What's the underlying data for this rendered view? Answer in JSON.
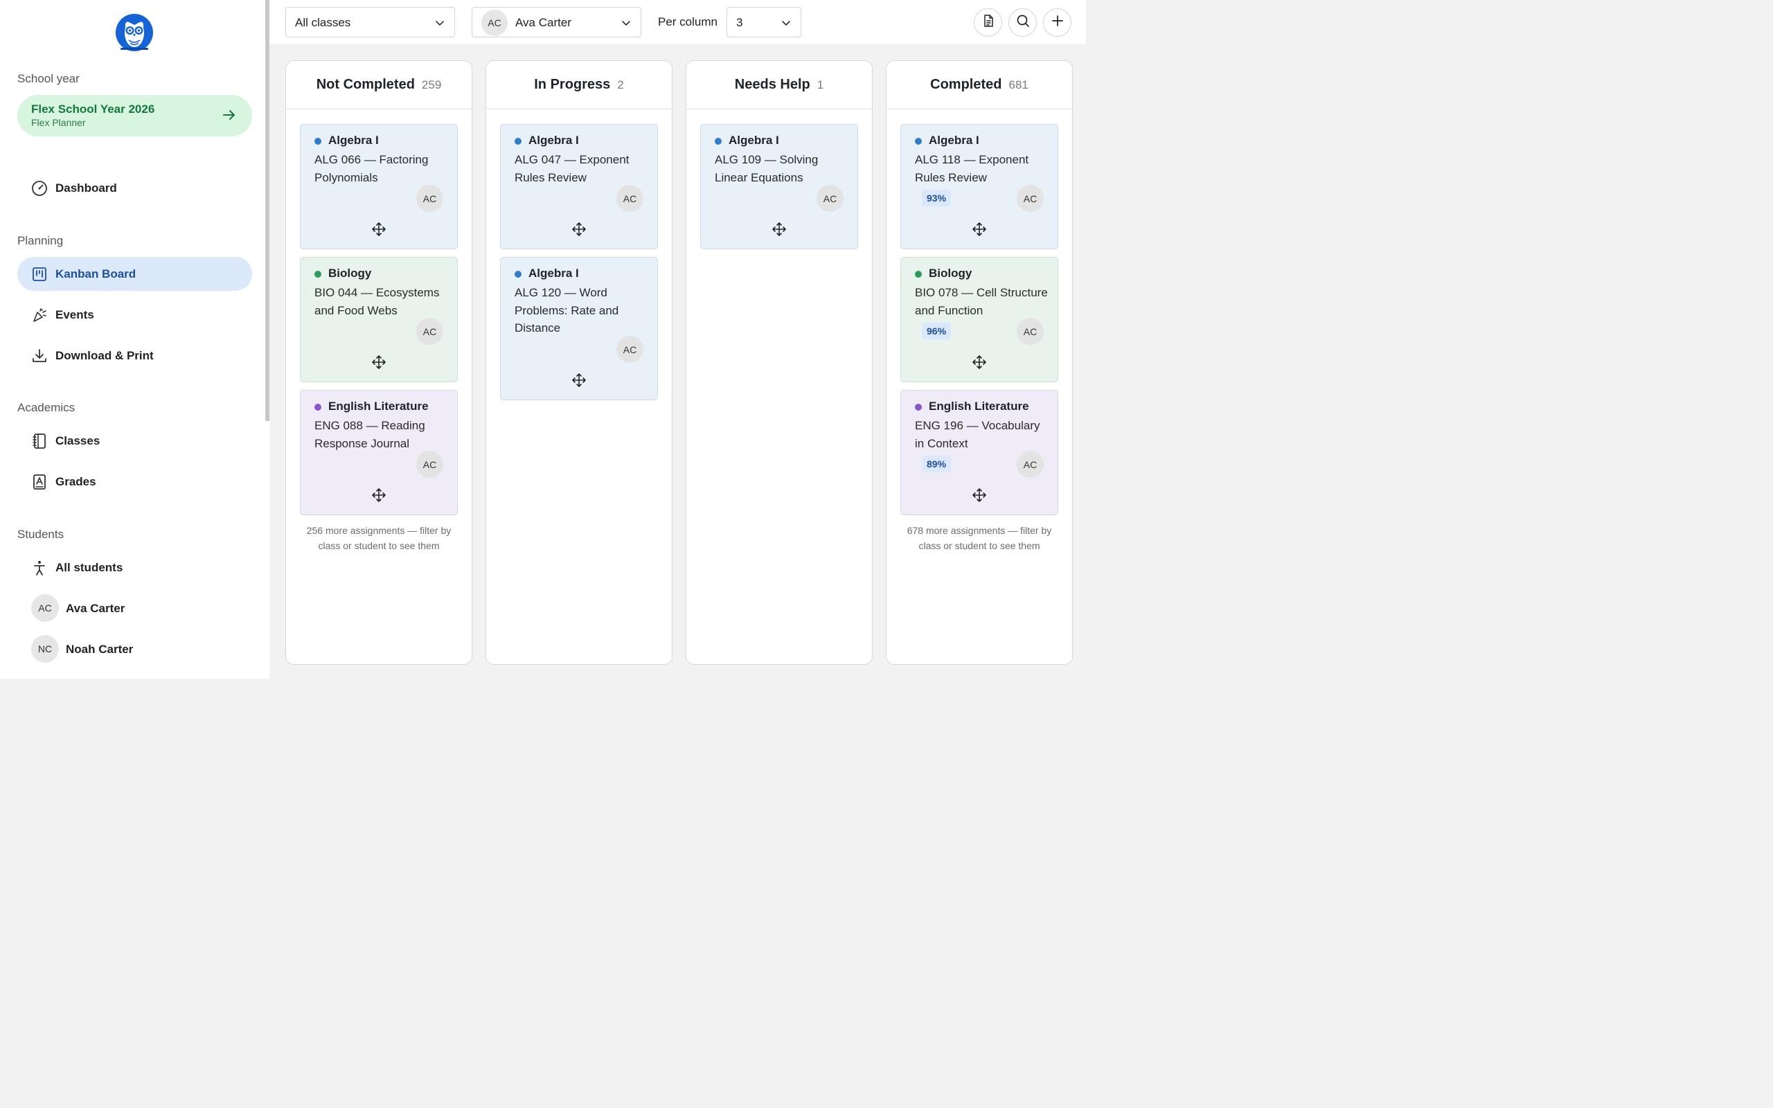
{
  "sidebar": {
    "logo_icon": "owl-logo-icon",
    "school_year_label": "School year",
    "year_card": {
      "title": "Flex School Year 2026",
      "subtitle": "Flex Planner"
    },
    "dashboard": "Dashboard",
    "planning_label": "Planning",
    "kanban": "Kanban Board",
    "events": "Events",
    "download": "Download & Print",
    "academics_label": "Academics",
    "classes": "Classes",
    "grades": "Grades",
    "students_label": "Students",
    "all_students": "All students",
    "students": [
      {
        "initials": "AC",
        "name": "Ava Carter"
      },
      {
        "initials": "NC",
        "name": "Noah Carter"
      }
    ]
  },
  "toolbar": {
    "class_filter": "All classes",
    "student_filter": {
      "initials": "AC",
      "name": "Ava Carter"
    },
    "per_column_label": "Per column",
    "per_column_value": "3"
  },
  "colors": {
    "algebra": "#2f7cc9",
    "biology": "#2e9a5a",
    "english": "#8a56c9",
    "active_nav": "#dce9fb",
    "year_card": "#d8f5df"
  },
  "columns": [
    {
      "title": "Not Completed",
      "count": "259",
      "cards": [
        {
          "cls": "Algebra I",
          "title": "ALG 066 — Factoring Polynomials",
          "avatar": "AC"
        },
        {
          "cls": "Biology",
          "title": "BIO 044 — Ecosystems and Food Webs",
          "avatar": "AC"
        },
        {
          "cls": "English Literature",
          "title": "ENG 088 — Reading Response Journal",
          "avatar": "AC"
        }
      ],
      "more": "256 more assignments — filter by class or student to see them"
    },
    {
      "title": "In Progress",
      "count": "2",
      "cards": [
        {
          "cls": "Algebra I",
          "title": "ALG 047 — Exponent Rules Review",
          "avatar": "AC"
        },
        {
          "cls": "Algebra I",
          "title": "ALG 120 — Word Problems: Rate and Distance",
          "avatar": "AC"
        }
      ]
    },
    {
      "title": "Needs Help",
      "count": "1",
      "cards": [
        {
          "cls": "Algebra I",
          "title": "ALG 109 — Solving Linear Equations",
          "avatar": "AC"
        }
      ]
    },
    {
      "title": "Completed",
      "count": "681",
      "cards": [
        {
          "cls": "Algebra I",
          "title": "ALG 118 — Exponent Rules Review",
          "avatar": "AC",
          "grade": "93%"
        },
        {
          "cls": "Biology",
          "title": "BIO 078 — Cell Structure and Function",
          "avatar": "AC",
          "grade": "96%"
        },
        {
          "cls": "English Literature",
          "title": "ENG 196 — Vocabulary in Context",
          "avatar": "AC",
          "grade": "89%"
        }
      ],
      "more": "678 more assignments — filter by class or student to see them"
    }
  ]
}
